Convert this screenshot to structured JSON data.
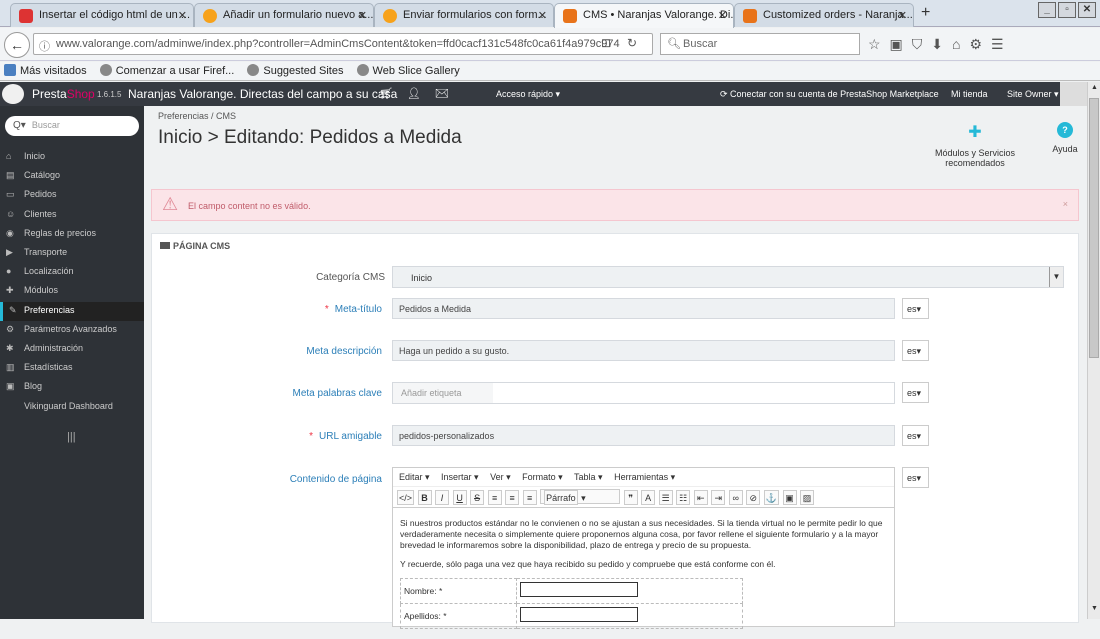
{
  "browser": {
    "tabs": [
      {
        "title": "Insertar el código html de un ...",
        "color": "#d33"
      },
      {
        "title": "Añadir un formulario nuevo a...",
        "color": "#f7a21b"
      },
      {
        "title": "Enviar formularios con form...",
        "color": "#f7a21b"
      },
      {
        "title": "CMS • Naranjas Valorange. Di...",
        "color": "#e8731a"
      },
      {
        "title": "Customized orders - Naranja...",
        "color": "#e8731a"
      }
    ],
    "url": "www.valorange.com/adminwe/index.php?controller=AdminCmsContent&token=ffd0cacf131c548fc0ca61f4a979c974",
    "search_placeholder": "Buscar",
    "bookmarks": [
      "Más visitados",
      "Comenzar a usar Firef...",
      "Suggested Sites",
      "Web Slice Gallery"
    ]
  },
  "header": {
    "brand_presta": "Presta",
    "brand_shop": "Shop",
    "version": "1.6.1.5",
    "shop_name": "Naranjas Valorange. Directas del campo a su casa",
    "quick_access": "Acceso rápido ▾",
    "connect": "Conectar con su cuenta de PrestaShop Marketplace",
    "my_shop": "Mi tienda",
    "owner": "Site Owner ▾"
  },
  "sidebar": {
    "search_placeholder": "Buscar",
    "items": [
      {
        "label": "Inicio",
        "icon": "home-icon"
      },
      {
        "label": "Catálogo",
        "icon": "catalog-icon"
      },
      {
        "label": "Pedidos",
        "icon": "orders-icon"
      },
      {
        "label": "Clientes",
        "icon": "customers-icon"
      },
      {
        "label": "Reglas de precios",
        "icon": "price-rules-icon"
      },
      {
        "label": "Transporte",
        "icon": "truck-icon"
      },
      {
        "label": "Localización",
        "icon": "globe-icon"
      },
      {
        "label": "Módulos",
        "icon": "puzzle-icon"
      },
      {
        "label": "Preferencias",
        "icon": "wrench-icon"
      },
      {
        "label": "Parámetros Avanzados",
        "icon": "cogs-icon"
      },
      {
        "label": "Administración",
        "icon": "gear-icon"
      },
      {
        "label": "Estadísticas",
        "icon": "stats-icon"
      },
      {
        "label": "Blog",
        "icon": "blog-icon"
      },
      {
        "label": "Vikinguard Dashboard",
        "icon": ""
      }
    ],
    "active_index": 8
  },
  "page": {
    "breadcrumb": "Preferencias  /  CMS",
    "title": "Inicio > Editando: Pedidos a Medida",
    "modules_btn": "Módulos y Servicios recomendados",
    "help_btn": "Ayuda",
    "alert": "El campo content no es válido.",
    "panel_title": "PÁGINA CMS"
  },
  "form": {
    "category_label": "Categoría CMS",
    "category_value": "Inicio",
    "meta_title_label": "Meta-título",
    "meta_title_value": "Pedidos a Medida",
    "meta_desc_label": "Meta descripción",
    "meta_desc_value": "Haga un pedido a su gusto.",
    "meta_keywords_label": "Meta palabras clave",
    "meta_keywords_placeholder": "Añadir etiqueta",
    "url_label": "URL amigable",
    "url_value": "pedidos-personalizados",
    "content_label": "Contenido de página",
    "lang": "es"
  },
  "editor": {
    "menus": [
      "Editar ▾",
      "Insertar ▾",
      "Ver ▾",
      "Formato ▾",
      "Tabla ▾",
      "Herramientas ▾"
    ],
    "format": "Párrafo",
    "paragraph1": "Si nuestros productos estándar no le convienen o no se ajustan a sus necesidades. Si la tienda virtual no le permite pedir lo que verdaderamente necesita o simplemente quiere proponernos alguna cosa, por favor rellene el siguiente formulario y a la mayor brevedad le informaremos sobre la disponibilidad, plazo de entrega y precio de su propuesta.",
    "paragraph2": "Y recuerde, sólo paga una vez que haya recibido su pedido y compruebe que está conforme con él.",
    "field1": "Nombre: *",
    "field2": "Apellidos: *"
  }
}
